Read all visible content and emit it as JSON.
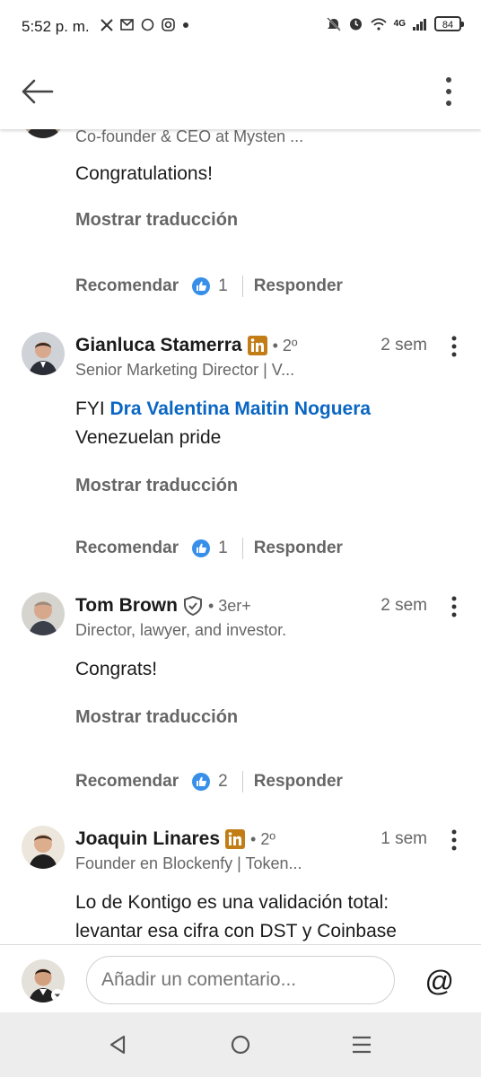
{
  "status": {
    "time": "5:52 p. m.",
    "network": "4G",
    "battery": "84"
  },
  "comments": [
    {
      "headline": "Co-founder & CEO at Mysten ...",
      "body": "Congratulations!",
      "translate": "Mostrar traducción",
      "like": "Recomendar",
      "count": "1",
      "reply": "Responder"
    },
    {
      "name": "Gianluca Stamerra",
      "degree": "• 2º",
      "time": "2 sem",
      "headline": "Senior Marketing Director | V...",
      "body_prefix": "FYI",
      "mention": "Dra Valentina Maitin Noguera",
      "body_line2": "Venezuelan pride",
      "translate": "Mostrar traducción",
      "like": "Recomendar",
      "count": "1",
      "reply": "Responder"
    },
    {
      "name": "Tom Brown",
      "degree": "• 3er+",
      "time": "2 sem",
      "headline": "Director, lawyer, and investor.",
      "body": "Congrats!",
      "translate": "Mostrar traducción",
      "like": "Recomendar",
      "count": "2",
      "reply": "Responder"
    },
    {
      "name": "Joaquin Linares",
      "degree": "• 2º",
      "time": "1 sem",
      "headline": "Founder en Blockenfy | Token...",
      "body_line1": "Lo de Kontigo es una validación total:",
      "body_line2": "levantar esa cifra con DST y Coinbase"
    }
  ],
  "composer": {
    "placeholder": "Añadir un comentario...",
    "mention_symbol": "@"
  },
  "colors": {
    "link": "#0a66c2",
    "linkedin_badge": "#c37d16"
  }
}
